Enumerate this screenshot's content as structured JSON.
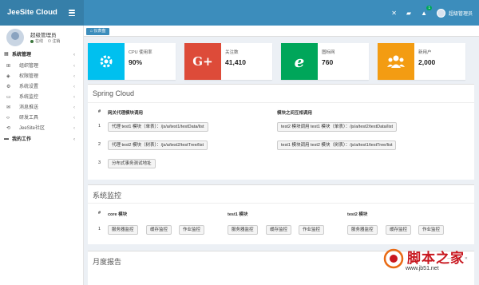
{
  "header": {
    "brand": "JeeSite Cloud",
    "notif_count": "1",
    "user_name": "超级管理员"
  },
  "sidebar": {
    "user": {
      "name": "超级管理员",
      "status_online": "在线",
      "status_logout": "注销"
    },
    "items": [
      {
        "label": "系统管理",
        "icon": "grid-icon",
        "kind": "head"
      },
      {
        "label": "组织管理",
        "icon": "sitemap-icon",
        "kind": "sub"
      },
      {
        "label": "权限管理",
        "icon": "shield-icon",
        "kind": "sub"
      },
      {
        "label": "系统设置",
        "icon": "gear-icon",
        "kind": "sub"
      },
      {
        "label": "系统监控",
        "icon": "monitor-icon",
        "kind": "sub"
      },
      {
        "label": "消息推送",
        "icon": "message-icon",
        "kind": "sub"
      },
      {
        "label": "研发工具",
        "icon": "code-icon",
        "kind": "sub"
      },
      {
        "label": "JeeSite社区",
        "icon": "share-icon",
        "kind": "sub"
      },
      {
        "label": "我的工作",
        "icon": "desktop-icon",
        "kind": "head"
      }
    ]
  },
  "tabs": {
    "home": "仪表盘"
  },
  "info_boxes": [
    {
      "label": "CPU 使用率",
      "value": "90%",
      "color": "#00c0ef",
      "icon": "gear-icon"
    },
    {
      "label": "关注数",
      "value": "41,410",
      "color": "#dd4b39",
      "icon": "google-plus-icon"
    },
    {
      "label": "图标网",
      "value": "760",
      "color": "#00a65a",
      "icon": "ie-icon"
    },
    {
      "label": "新用户",
      "value": "2,000",
      "color": "#f39c12",
      "icon": "users-icon"
    }
  ],
  "spring_cloud": {
    "title": "Spring Cloud",
    "col_num": "#",
    "col_a": "网关代理模块调用",
    "col_b": "模块之间互相调用",
    "rows": [
      {
        "num": "1",
        "a": "代理 test1 模块（单表）：/js/a/test1/testData/list",
        "b": "test2 模块调用 test1 模块（单表）：/js/a/test2/testData/list"
      },
      {
        "num": "2",
        "a": "代理 test2 模块（树表）：/js/a/test2/testTree/list",
        "b": "test1 模块调用 test2 模块（树表）：/js/a/test1/testTree/list"
      },
      {
        "num": "3",
        "a": "分布式事务测试地址",
        "b": ""
      }
    ]
  },
  "sys_monitor": {
    "title": "系统监控",
    "col_num": "#",
    "cols": [
      "core 模块",
      "test1 模块",
      "test2 模块"
    ],
    "row_num": "1",
    "buttons": [
      "服务器监控",
      "缓存监控",
      "作业监控"
    ]
  },
  "monthly": {
    "title": "月度报告"
  },
  "watermark": {
    "text": "脚本之家",
    "url": "www.jb51.net"
  }
}
